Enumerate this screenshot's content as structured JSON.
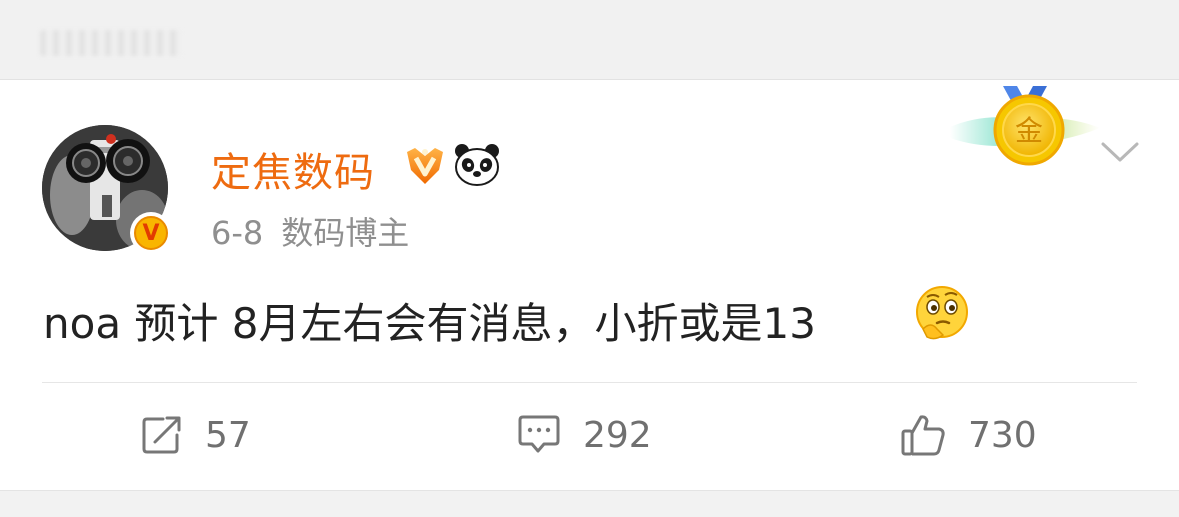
{
  "post": {
    "author": {
      "name": "定焦数码",
      "badge_letter": "V",
      "medal_label": "金"
    },
    "meta": {
      "date": "6-8",
      "source": "数码博主"
    },
    "text": "noa 预计 8月左右会有消息，小折或是13",
    "emoji": "thinking-face"
  },
  "actions": {
    "repost_count": "57",
    "comment_count": "292",
    "like_count": "730"
  },
  "colors": {
    "username": "#ee6b10",
    "meta": "#8f8f8f",
    "body_text": "#222222",
    "action": "#777777",
    "medal_gold": "#f5c518"
  },
  "icons": [
    "vip-crown-icon",
    "panda-icon",
    "gold-medal-icon",
    "chevron-down-icon",
    "repost-icon",
    "comment-icon",
    "like-icon"
  ]
}
